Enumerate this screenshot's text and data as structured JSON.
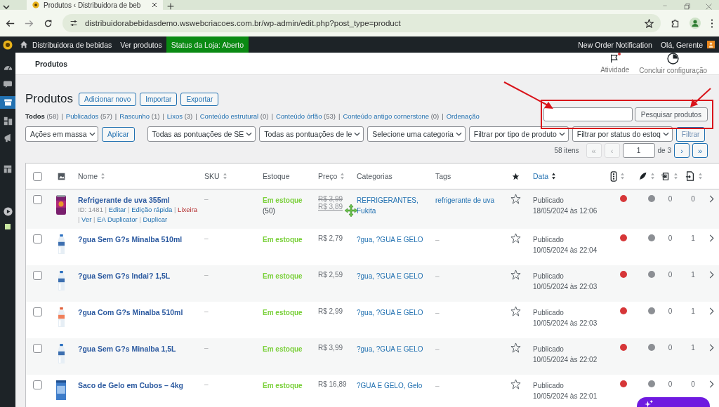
{
  "browser": {
    "tab_title": "Produtos ‹ Distribuidora de beb",
    "url": "distribuidorabebidasdemo.wswebcriacoes.com.br/wp-admin/edit.php?post_type=product"
  },
  "admin_bar": {
    "site": "Distribuidora de bebidas",
    "view_products": "Ver produtos",
    "store_status": "Status da Loja: Aberto",
    "notification": "New Order Notification",
    "greeting": "Olá, Gerente"
  },
  "header": {
    "title": "Produtos",
    "actions": [
      {
        "label": "Atividade",
        "kind": "activity",
        "alert": true
      },
      {
        "label": "Concluir configuração",
        "kind": "setup",
        "alert": false
      }
    ]
  },
  "page": {
    "title": "Produtos",
    "buttons": [
      "Adicionar novo",
      "Importar",
      "Exportar"
    ]
  },
  "views": {
    "separator": "|",
    "items": [
      {
        "label": "Todos",
        "count": "(58)",
        "selected": true
      },
      {
        "label": "Publicados",
        "count": "(57)",
        "selected": false
      },
      {
        "label": "Rascunho",
        "count": "(1)",
        "selected": false
      },
      {
        "label": "Lixos",
        "count": "(3)",
        "selected": false
      },
      {
        "label": "Conteúdo estrutural",
        "count": "(0)",
        "selected": false
      },
      {
        "label": "Conteúdo órfão",
        "count": "(53)",
        "selected": false
      },
      {
        "label": "Conteúdo antigo cornerstone",
        "count": "(0)",
        "selected": false
      },
      {
        "label": "Ordenação",
        "selected": false
      }
    ]
  },
  "search": {
    "button": "Pesquisar produtos"
  },
  "filters": {
    "bulk_action": "Ações em massa",
    "apply": "Aplicar",
    "selects": [
      "Todas as pontuações de SE",
      "Todas as pontuações de le",
      "Selecione uma categoria",
      "Filtrar por tipo de produto",
      "Filtrar por status do estoq"
    ],
    "filter_button": "Filtrar"
  },
  "pagination": {
    "count": "58 itens",
    "first": {
      "label": "«",
      "disabled": true
    },
    "prev": {
      "label": "‹",
      "disabled": true
    },
    "page": "1",
    "of": "de 3",
    "next": {
      "label": "›",
      "disabled": false
    },
    "last": {
      "label": "»",
      "disabled": false
    }
  },
  "table": {
    "columns": [
      {
        "kind": "checkbox"
      },
      {
        "kind": "thumbnail"
      },
      {
        "kind": "text",
        "label": "Nome",
        "sortable": true,
        "sorted": false
      },
      {
        "kind": "text",
        "label": "SKU",
        "sortable": true,
        "sorted": false
      },
      {
        "kind": "text",
        "label": "Estoque"
      },
      {
        "kind": "text",
        "label": "Preço",
        "sortable": true,
        "sorted": false
      },
      {
        "kind": "text",
        "label": "Categorias"
      },
      {
        "kind": "text",
        "label": "Tags"
      },
      {
        "kind": "featured"
      },
      {
        "kind": "text",
        "label": "Data",
        "sortable": true,
        "sorted": true
      },
      {
        "kind": "seo",
        "sortable": true,
        "sorted": false
      },
      {
        "kind": "readability",
        "sortable": true,
        "sorted": false
      },
      {
        "kind": "links_out",
        "sortable": true,
        "sorted": false
      },
      {
        "kind": "links_in",
        "sortable": true,
        "sorted": false
      }
    ],
    "select_all": {
      "checked": false
    },
    "rows": [
      {
        "checked": false,
        "name": "Refrigerante de uva 355ml",
        "row_actions": {
          "id": "ID: 1481",
          "separator": "|",
          "links": [
            {
              "label": "Editar",
              "kind": "normal"
            },
            {
              "label": "Edição rápida",
              "kind": "normal"
            },
            {
              "label": "Lixeira",
              "kind": "danger"
            },
            {
              "label": "Ver",
              "kind": "normal"
            },
            {
              "label": "EA Duplicator",
              "kind": "normal"
            },
            {
              "label": "Duplicar",
              "kind": "normal"
            }
          ]
        },
        "sku": "–",
        "stock": "Em estoque",
        "stock_count": "(50)",
        "prices": [
          {
            "text": "R$ 3,99",
            "kind": "old"
          },
          {
            "text": "R$ 3,89",
            "kind": "sale"
          }
        ],
        "categories": "REFRIGERANTES, Fukita",
        "tags": {
          "text": "refrigerante de uva",
          "link": true
        },
        "featured": false,
        "status": "Publicado",
        "date": "18/05/2024 às 12:06",
        "scores": [
          {
            "color": "#d63638"
          },
          {
            "color": "#8c8f94"
          }
        ],
        "links_out": "0",
        "links_in": "0"
      },
      {
        "checked": false,
        "name": "?gua Sem G?s Minalba 510ml",
        "sku": "–",
        "stock": "Em estoque",
        "prices": [
          {
            "text": "R$ 2,79",
            "kind": "regular"
          }
        ],
        "categories": "?gua, ?GUA E GELO",
        "tags": {
          "text": "–",
          "link": false
        },
        "featured": false,
        "status": "Publicado",
        "date": "10/05/2024 às 22:04",
        "scores": [
          {
            "color": "#d63638"
          },
          {
            "color": "#8c8f94"
          }
        ],
        "links_out": "0",
        "links_in": "1"
      },
      {
        "checked": false,
        "name": "?gua Sem G?s Indai? 1,5L",
        "sku": "–",
        "stock": "Em estoque",
        "prices": [
          {
            "text": "R$ 2,59",
            "kind": "regular"
          }
        ],
        "categories": "?gua, ?GUA E GELO",
        "tags": {
          "text": "–",
          "link": false
        },
        "featured": false,
        "status": "Publicado",
        "date": "10/05/2024 às 22:03",
        "scores": [
          {
            "color": "#d63638"
          },
          {
            "color": "#8c8f94"
          }
        ],
        "links_out": "0",
        "links_in": "1"
      },
      {
        "checked": false,
        "name": "?gua Com G?s Minalba 510ml",
        "sku": "–",
        "stock": "Em estoque",
        "prices": [
          {
            "text": "R$ 2,99",
            "kind": "regular"
          }
        ],
        "categories": "?gua, ?GUA E GELO",
        "tags": {
          "text": "–",
          "link": false
        },
        "featured": false,
        "status": "Publicado",
        "date": "10/05/2024 às 22:03",
        "scores": [
          {
            "color": "#d63638"
          },
          {
            "color": "#8c8f94"
          }
        ],
        "links_out": "0",
        "links_in": "1"
      },
      {
        "checked": false,
        "name": "?gua Sem G?s Minalba 1,5L",
        "sku": "–",
        "stock": "Em estoque",
        "prices": [
          {
            "text": "R$ 3,99",
            "kind": "regular"
          }
        ],
        "categories": "?gua, ?GUA E GELO",
        "tags": {
          "text": "–",
          "link": false
        },
        "featured": false,
        "status": "Publicado",
        "date": "10/05/2024 às 22:02",
        "scores": [
          {
            "color": "#d63638"
          },
          {
            "color": "#8c8f94"
          }
        ],
        "links_out": "0",
        "links_in": "1"
      },
      {
        "checked": false,
        "name": "Saco de Gelo em Cubos – 4kg",
        "sku": "–",
        "stock": "Em estoque",
        "prices": [
          {
            "text": "R$ 16,89",
            "kind": "regular"
          }
        ],
        "categories": "?GUA E GELO, Gelo",
        "tags": {
          "text": "–",
          "link": false
        },
        "featured": false,
        "status": "Publicado",
        "date": "10/05/2024 às 22:01",
        "scores": [
          {
            "color": "#d63638"
          },
          {
            "color": "#8c8f94"
          }
        ],
        "links_out": "0",
        "links_in": "0"
      }
    ]
  }
}
